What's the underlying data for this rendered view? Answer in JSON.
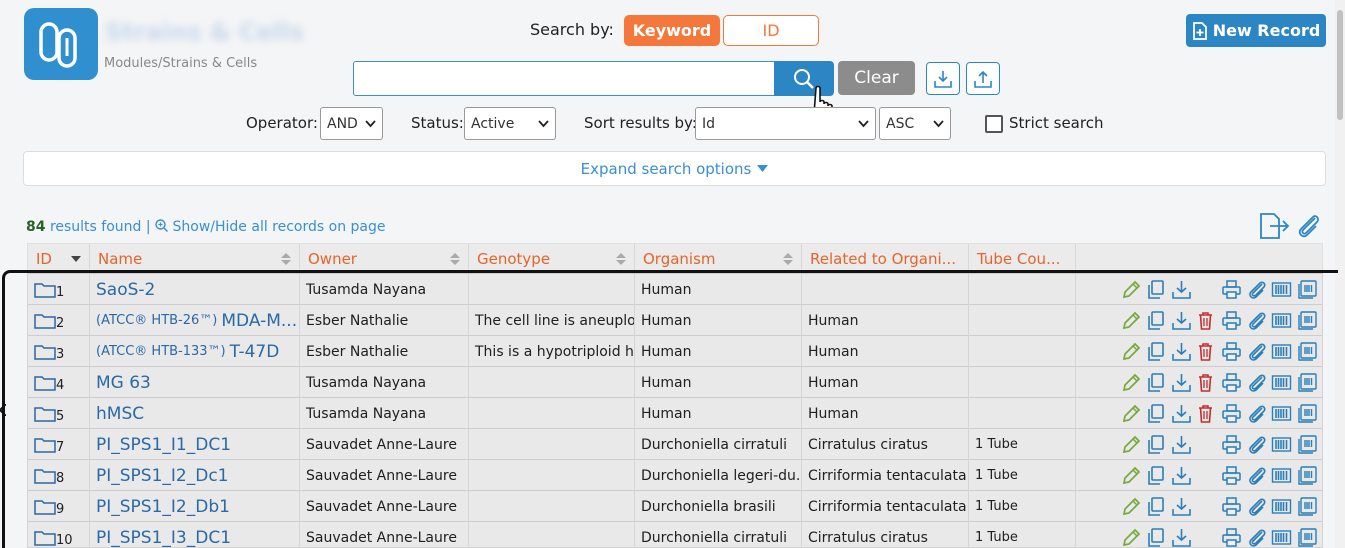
{
  "header": {
    "app_title": "Strains & Cells",
    "breadcrumb": "Modules/Strains & Cells",
    "search_by_label": "Search by:",
    "keyword_label": "Keyword",
    "id_label": "ID",
    "new_record_label": "New Record",
    "search_value": "",
    "clear_label": "Clear"
  },
  "filters": {
    "operator_label": "Operator:",
    "operator_value": "AND",
    "status_label": "Status:",
    "status_value": "Active",
    "sort_label": "Sort results by:",
    "sort_value": "Id",
    "order_value": "ASC",
    "strict_label": "Strict search",
    "expand_label": "Expand search options"
  },
  "results": {
    "count": "84",
    "found_label": "results found |",
    "toggle_label": "Show/Hide all records on page"
  },
  "columns": [
    "ID",
    "Name",
    "Owner",
    "Genotype",
    "Organism",
    "Related to Organi...",
    "Tube Cou..."
  ],
  "rows": [
    {
      "id": "1",
      "prefix": "",
      "name": "SaoS-2",
      "owner": "Tusamda Nayana",
      "genotype": "",
      "organism": "Human",
      "related": "",
      "tubes": "",
      "trash": false
    },
    {
      "id": "2",
      "prefix": "(ATCC® HTB-26™)",
      "name": "MDA-M...",
      "owner": "Esber Nathalie",
      "genotype": "The cell line is aneuplo...",
      "organism": "Human",
      "related": "Human",
      "tubes": "",
      "trash": true
    },
    {
      "id": "3",
      "prefix": "(ATCC® HTB-133™)",
      "name": "T-47D",
      "owner": "Esber Nathalie",
      "genotype": "This is a hypotriploid h...",
      "organism": "Human",
      "related": "Human",
      "tubes": "",
      "trash": true
    },
    {
      "id": "4",
      "prefix": "",
      "name": "MG 63",
      "owner": "Tusamda Nayana",
      "genotype": "",
      "organism": "Human",
      "related": "Human",
      "tubes": "",
      "trash": true
    },
    {
      "id": "5",
      "prefix": "",
      "name": "hMSC",
      "owner": "Tusamda Nayana",
      "genotype": "",
      "organism": "Human",
      "related": "Human",
      "tubes": "",
      "trash": true
    },
    {
      "id": "7",
      "prefix": "",
      "name": "PI_SPS1_I1_DC1",
      "owner": "Sauvadet Anne-Laure",
      "genotype": "",
      "organism": "Durchoniella cirratuli",
      "related": "Cirratulus ciratus",
      "tubes": "1 Tube",
      "trash": false
    },
    {
      "id": "8",
      "prefix": "",
      "name": "PI_SPS1_I2_Dc1",
      "owner": "Sauvadet Anne-Laure",
      "genotype": "",
      "organism": "Durchoniella legeri-du...",
      "related": "Cirriformia tentaculata",
      "tubes": "1 Tube",
      "trash": false
    },
    {
      "id": "9",
      "prefix": "",
      "name": "PI_SPS1_I2_Db1",
      "owner": "Sauvadet Anne-Laure",
      "genotype": "",
      "organism": "Durchoniella brasili",
      "related": "Cirriformia tentaculata",
      "tubes": "1 Tube",
      "trash": false
    },
    {
      "id": "10",
      "prefix": "",
      "name": "PI_SPS1_I3_DC1",
      "owner": "Sauvadet Anne-Laure",
      "genotype": "",
      "organism": "Durchoniella cirratuli",
      "related": "Cirratulus ciratus",
      "tubes": "1 Tube",
      "trash": false
    }
  ],
  "colors": {
    "accent_orange": "#f4773b",
    "primary_blue": "#2d86c4",
    "edit_green": "#7cb342",
    "delete_red": "#d32f2f"
  }
}
